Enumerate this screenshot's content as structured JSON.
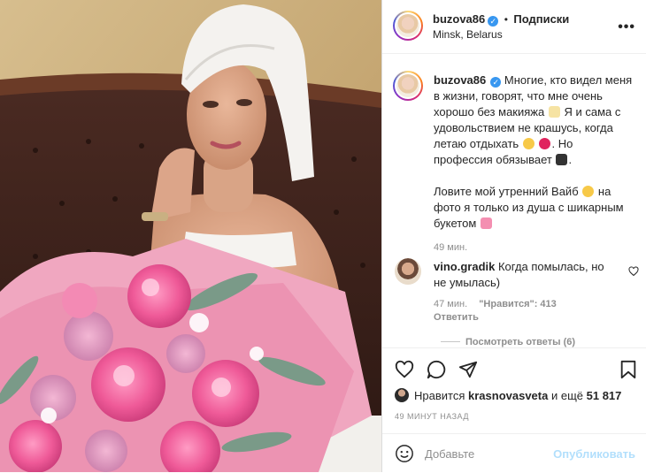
{
  "post": {
    "username": "buzova86",
    "follow_label": "Подписки",
    "separator": "•",
    "location": "Minsk, Belarus",
    "more_icon": "more-horizontal-icon",
    "verified_mark": "✓"
  },
  "caption": {
    "username": "buzova86",
    "text_1": "Многие, кто видел меня в жизни, говорят, что мне очень хорошо без макияжа",
    "text_2": "Я и сама с удовольствием не крашусь, когда летаю отдыхать",
    "text_3": ". Но профессия обязывает",
    "text_4": ".",
    "text_5": "Ловите мой утренний Вайб",
    "text_6": "на фото я только из душа с шикарным букетом",
    "time": "49 мин."
  },
  "comment": {
    "username": "vino.gradik",
    "text": "Когда помылась, но не умылась)",
    "time": "47 мин.",
    "likes": "\"Нравится\": 413",
    "reply": "Ответить",
    "view_replies": "Посмотреть ответы (6)"
  },
  "likes": {
    "prefix": "Нравится",
    "user": "krasnovasveta",
    "suffix": "и ещё",
    "count": "51 817"
  },
  "timestamp": "49 МИНУТ НАЗАД",
  "composer": {
    "placeholder": "Добавьте",
    "publish": "Опубликовать"
  },
  "colors": {
    "verified": "#3897f0",
    "publish_disabled": "#b2dffc",
    "meta": "#8e8e8e"
  }
}
